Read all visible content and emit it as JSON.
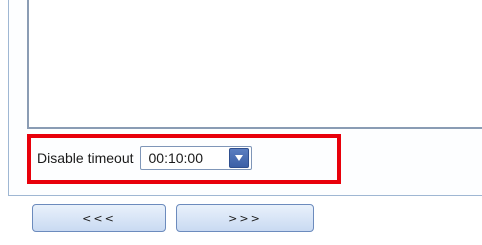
{
  "settings": {
    "disable_timeout_label": "Disable timeout",
    "disable_timeout_value": "00:10:00"
  },
  "navigation": {
    "prev_label": "<<<",
    "next_label": ">>>"
  },
  "icons": {
    "time_dropdown": "chevron-down-icon"
  },
  "colors": {
    "highlight": "#e8000b",
    "dropdown_button": "#3b5fa6",
    "button_border": "#6c8bbd"
  }
}
